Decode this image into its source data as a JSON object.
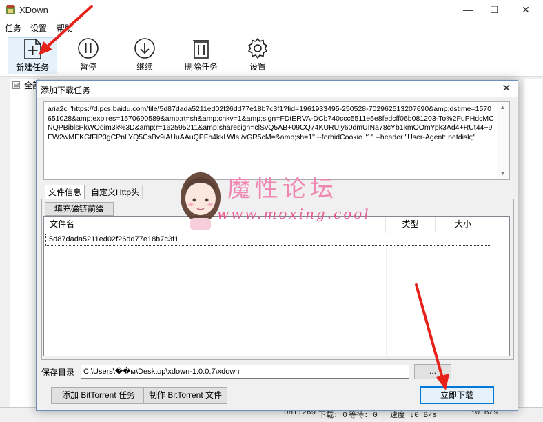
{
  "app": {
    "title": "XDown",
    "minimize_glyph": "—",
    "maximize_glyph": "☐",
    "close_glyph": "✕"
  },
  "menu": [
    "任务",
    "设置",
    "帮助"
  ],
  "toolbar": [
    {
      "label": "新建任务",
      "icon": "new-task-icon"
    },
    {
      "label": "暂停",
      "icon": "pause-icon"
    },
    {
      "label": "继续",
      "icon": "resume-icon"
    },
    {
      "label": "删除任务",
      "icon": "trash-icon"
    },
    {
      "label": "设置",
      "icon": "gear-icon"
    }
  ],
  "tree": {
    "toggle": "⊟",
    "root_label": "全部"
  },
  "status": {
    "dht": "DHT:269",
    "downloading": "下载: 0",
    "waiting": "等待: 0",
    "speed": "速度 ↓0 B/s",
    "upload": "↑0 B/s"
  },
  "dialog": {
    "title": "添加下载任务",
    "close_glyph": "✕",
    "command": "aria2c \"https://d.pcs.baidu.com/file/5d87dada5211ed02f26dd77e18b7c3f1?fid=1961933495-250528-702962513207690&amp;dstime=1570651028&amp;expires=1570690589&amp;rt=sh&amp;chkv=1&amp;sign=FDtERVA-DCb740ccc5511e5e8fedcff06b081203-To%2FuPHdcMCNQPBiblsPkWOoim3k%3D&amp;r=162595211&amp;sharesign=clSvQ5AB+09CQ74KURUly60dmUINa78cYb1kmOOmYpk3Ad4+RUt44+9EW2wMEKGfFlP3gCPnLYQ5CsBv9iAUuAAuQPFb4kkLWlsI/vGR5cM=&amp;sh=1\" --forbidCookie \"1\" --header \"User-Agent: netdisk;\"",
    "scroll_up": "▲",
    "scroll_down": "▼",
    "tabs": [
      {
        "label": "文件信息",
        "active": true
      },
      {
        "label": "自定义Http头",
        "active": false
      }
    ],
    "magnet_prefix_button": "填充磁链前缀",
    "table": {
      "columns": [
        "文件名",
        "类型",
        "大小"
      ],
      "rows": [
        {
          "name": "5d87dada5211ed02f26dd77e18b7c3f1",
          "type": "",
          "size": ""
        }
      ]
    },
    "save_dir_label": "保存目录",
    "save_dir_value": "C:\\Users\\��м\\Desktop\\xdown-1.0.0.7\\xdown",
    "browse_button": "...",
    "add_bittorrent_button": "添加 BitTorrent 任务",
    "make_bittorrent_button": "制作 BitTorrent 文件",
    "download_now_button": "立即下载"
  },
  "watermark": {
    "title": "魔性论坛",
    "url": "www.moxing.cool"
  },
  "colors": {
    "accent": "#0078d7",
    "arrow": "#e8201a",
    "watermark": "#f27cab"
  }
}
